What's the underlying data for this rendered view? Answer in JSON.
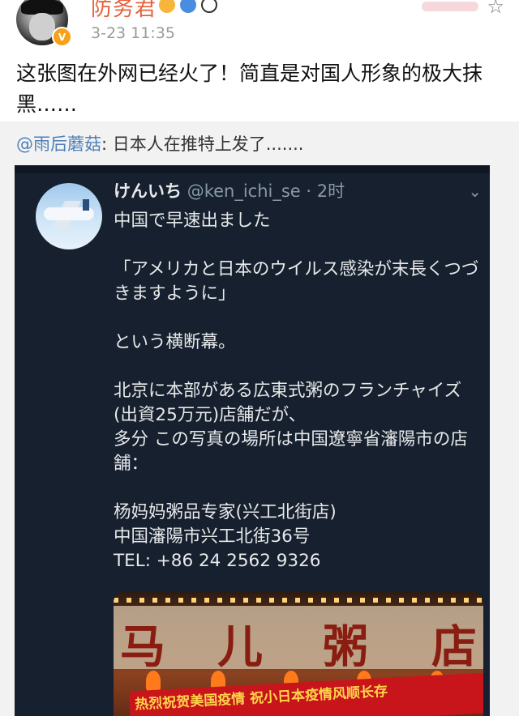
{
  "header": {
    "username": "防务君",
    "timestamp": "3-23 11:35",
    "verified_mark": "V"
  },
  "post": {
    "text": "这张图在外网已经火了！简直是对国人形象的极大抹黑……"
  },
  "repost": {
    "mention": "@雨后蘑菇",
    "text": ": 日本人在推特上发了......."
  },
  "tweet": {
    "author_name": "けんいち",
    "author_handle": "@ken_ichi_se",
    "age": "· 2时",
    "chevron": "⌄",
    "body": "中国で早速出ました\n\n「アメリカと日本のウイルス感染が末長くつづきますように」\n\nという横断幕。\n\n北京に本部がある広東式粥のフランチャイズ(出資25万元)店舗だが、\n多分 この写真の場所は中国遼寧省瀋陽市の店舗：\n\n杨妈妈粥品专家(兴工北街店)\n中国瀋陽市兴工北街36号\nTEL: +86 24 2562 9326",
    "photo": {
      "sign_left": "马",
      "sign_mid1": "儿",
      "sign_mid2": "粥",
      "sign_right": "店",
      "banner": "热烈祝贺美国疫情 祝小日本疫情风顺长存"
    }
  },
  "icons": {
    "star": "star-icon",
    "chevron": "chevron-down-icon"
  },
  "colors": {
    "username": "#e5613c",
    "mention": "#4f7fb8",
    "tweet_bg": "#16202e",
    "banner": "#c8141b"
  }
}
